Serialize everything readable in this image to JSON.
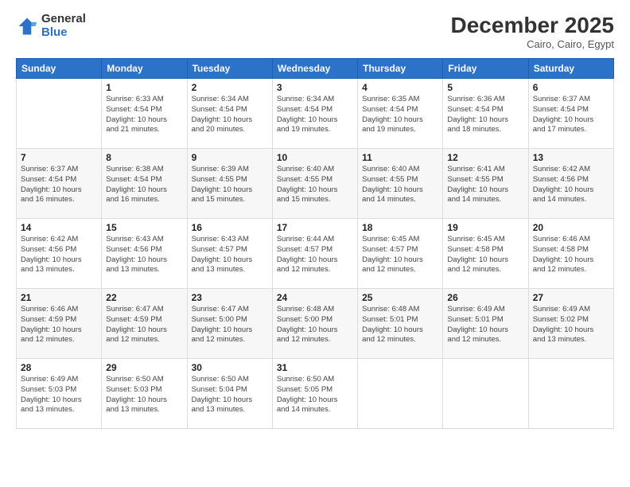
{
  "logo": {
    "general": "General",
    "blue": "Blue"
  },
  "title": {
    "month": "December 2025",
    "location": "Cairo, Cairo, Egypt"
  },
  "headers": [
    "Sunday",
    "Monday",
    "Tuesday",
    "Wednesday",
    "Thursday",
    "Friday",
    "Saturday"
  ],
  "weeks": [
    [
      {
        "day": "",
        "info": ""
      },
      {
        "day": "1",
        "info": "Sunrise: 6:33 AM\nSunset: 4:54 PM\nDaylight: 10 hours\nand 21 minutes."
      },
      {
        "day": "2",
        "info": "Sunrise: 6:34 AM\nSunset: 4:54 PM\nDaylight: 10 hours\nand 20 minutes."
      },
      {
        "day": "3",
        "info": "Sunrise: 6:34 AM\nSunset: 4:54 PM\nDaylight: 10 hours\nand 19 minutes."
      },
      {
        "day": "4",
        "info": "Sunrise: 6:35 AM\nSunset: 4:54 PM\nDaylight: 10 hours\nand 19 minutes."
      },
      {
        "day": "5",
        "info": "Sunrise: 6:36 AM\nSunset: 4:54 PM\nDaylight: 10 hours\nand 18 minutes."
      },
      {
        "day": "6",
        "info": "Sunrise: 6:37 AM\nSunset: 4:54 PM\nDaylight: 10 hours\nand 17 minutes."
      }
    ],
    [
      {
        "day": "7",
        "info": "Sunrise: 6:37 AM\nSunset: 4:54 PM\nDaylight: 10 hours\nand 16 minutes."
      },
      {
        "day": "8",
        "info": "Sunrise: 6:38 AM\nSunset: 4:54 PM\nDaylight: 10 hours\nand 16 minutes."
      },
      {
        "day": "9",
        "info": "Sunrise: 6:39 AM\nSunset: 4:55 PM\nDaylight: 10 hours\nand 15 minutes."
      },
      {
        "day": "10",
        "info": "Sunrise: 6:40 AM\nSunset: 4:55 PM\nDaylight: 10 hours\nand 15 minutes."
      },
      {
        "day": "11",
        "info": "Sunrise: 6:40 AM\nSunset: 4:55 PM\nDaylight: 10 hours\nand 14 minutes."
      },
      {
        "day": "12",
        "info": "Sunrise: 6:41 AM\nSunset: 4:55 PM\nDaylight: 10 hours\nand 14 minutes."
      },
      {
        "day": "13",
        "info": "Sunrise: 6:42 AM\nSunset: 4:56 PM\nDaylight: 10 hours\nand 14 minutes."
      }
    ],
    [
      {
        "day": "14",
        "info": "Sunrise: 6:42 AM\nSunset: 4:56 PM\nDaylight: 10 hours\nand 13 minutes."
      },
      {
        "day": "15",
        "info": "Sunrise: 6:43 AM\nSunset: 4:56 PM\nDaylight: 10 hours\nand 13 minutes."
      },
      {
        "day": "16",
        "info": "Sunrise: 6:43 AM\nSunset: 4:57 PM\nDaylight: 10 hours\nand 13 minutes."
      },
      {
        "day": "17",
        "info": "Sunrise: 6:44 AM\nSunset: 4:57 PM\nDaylight: 10 hours\nand 12 minutes."
      },
      {
        "day": "18",
        "info": "Sunrise: 6:45 AM\nSunset: 4:57 PM\nDaylight: 10 hours\nand 12 minutes."
      },
      {
        "day": "19",
        "info": "Sunrise: 6:45 AM\nSunset: 4:58 PM\nDaylight: 10 hours\nand 12 minutes."
      },
      {
        "day": "20",
        "info": "Sunrise: 6:46 AM\nSunset: 4:58 PM\nDaylight: 10 hours\nand 12 minutes."
      }
    ],
    [
      {
        "day": "21",
        "info": "Sunrise: 6:46 AM\nSunset: 4:59 PM\nDaylight: 10 hours\nand 12 minutes."
      },
      {
        "day": "22",
        "info": "Sunrise: 6:47 AM\nSunset: 4:59 PM\nDaylight: 10 hours\nand 12 minutes."
      },
      {
        "day": "23",
        "info": "Sunrise: 6:47 AM\nSunset: 5:00 PM\nDaylight: 10 hours\nand 12 minutes."
      },
      {
        "day": "24",
        "info": "Sunrise: 6:48 AM\nSunset: 5:00 PM\nDaylight: 10 hours\nand 12 minutes."
      },
      {
        "day": "25",
        "info": "Sunrise: 6:48 AM\nSunset: 5:01 PM\nDaylight: 10 hours\nand 12 minutes."
      },
      {
        "day": "26",
        "info": "Sunrise: 6:49 AM\nSunset: 5:01 PM\nDaylight: 10 hours\nand 12 minutes."
      },
      {
        "day": "27",
        "info": "Sunrise: 6:49 AM\nSunset: 5:02 PM\nDaylight: 10 hours\nand 13 minutes."
      }
    ],
    [
      {
        "day": "28",
        "info": "Sunrise: 6:49 AM\nSunset: 5:03 PM\nDaylight: 10 hours\nand 13 minutes."
      },
      {
        "day": "29",
        "info": "Sunrise: 6:50 AM\nSunset: 5:03 PM\nDaylight: 10 hours\nand 13 minutes."
      },
      {
        "day": "30",
        "info": "Sunrise: 6:50 AM\nSunset: 5:04 PM\nDaylight: 10 hours\nand 13 minutes."
      },
      {
        "day": "31",
        "info": "Sunrise: 6:50 AM\nSunset: 5:05 PM\nDaylight: 10 hours\nand 14 minutes."
      },
      {
        "day": "",
        "info": ""
      },
      {
        "day": "",
        "info": ""
      },
      {
        "day": "",
        "info": ""
      }
    ]
  ]
}
